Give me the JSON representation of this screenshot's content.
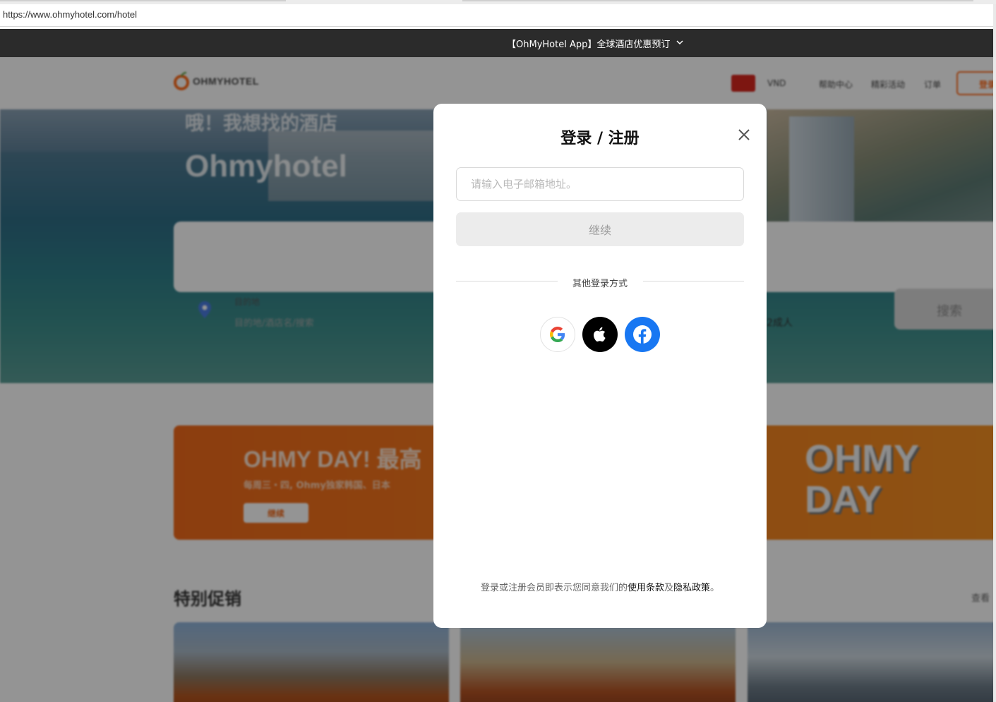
{
  "browser": {
    "url": "https://www.ohmyhotel.com/hotel"
  },
  "top_banner": {
    "text": "【OhMyHotel App】全球酒店优惠预订"
  },
  "background_page": {
    "brand": "OHMYHOTEL",
    "currency": "VND",
    "nav": [
      "帮助中心",
      "精彩活动",
      "订单"
    ],
    "login_label": "登录",
    "hero_subtitle": "哦！我想找的酒店",
    "hero_title": "Ohmyhotel",
    "search": {
      "destination_label": "目的地",
      "destination_placeholder": "目的地/酒店名/搜索",
      "guests": "2成人",
      "search_label": "搜索"
    },
    "promo": {
      "title": "OHMY DAY! 最高",
      "subtitle": "每周三・四, Ohmy独家韩国、日本",
      "button": "继续",
      "logo": "OHMY\nDAY"
    },
    "special_section": {
      "title": "特别促销",
      "view_all": "查看"
    }
  },
  "modal": {
    "title": "登录 / 注册",
    "email_placeholder": "请输入电子邮箱地址。",
    "continue_label": "继续",
    "other_login_label": "其他登录方式",
    "social": [
      "google-icon",
      "apple-icon",
      "facebook-icon"
    ],
    "terms": {
      "prefix": "登录或注册会员即表示您同意我们的",
      "terms_link": "使用条款",
      "and": "及",
      "privacy_link": "隐私政策",
      "suffix": "。"
    }
  },
  "colors": {
    "accent": "#ff6a1a",
    "facebook": "#1877f2",
    "banner_bg": "#2b2b2b"
  }
}
